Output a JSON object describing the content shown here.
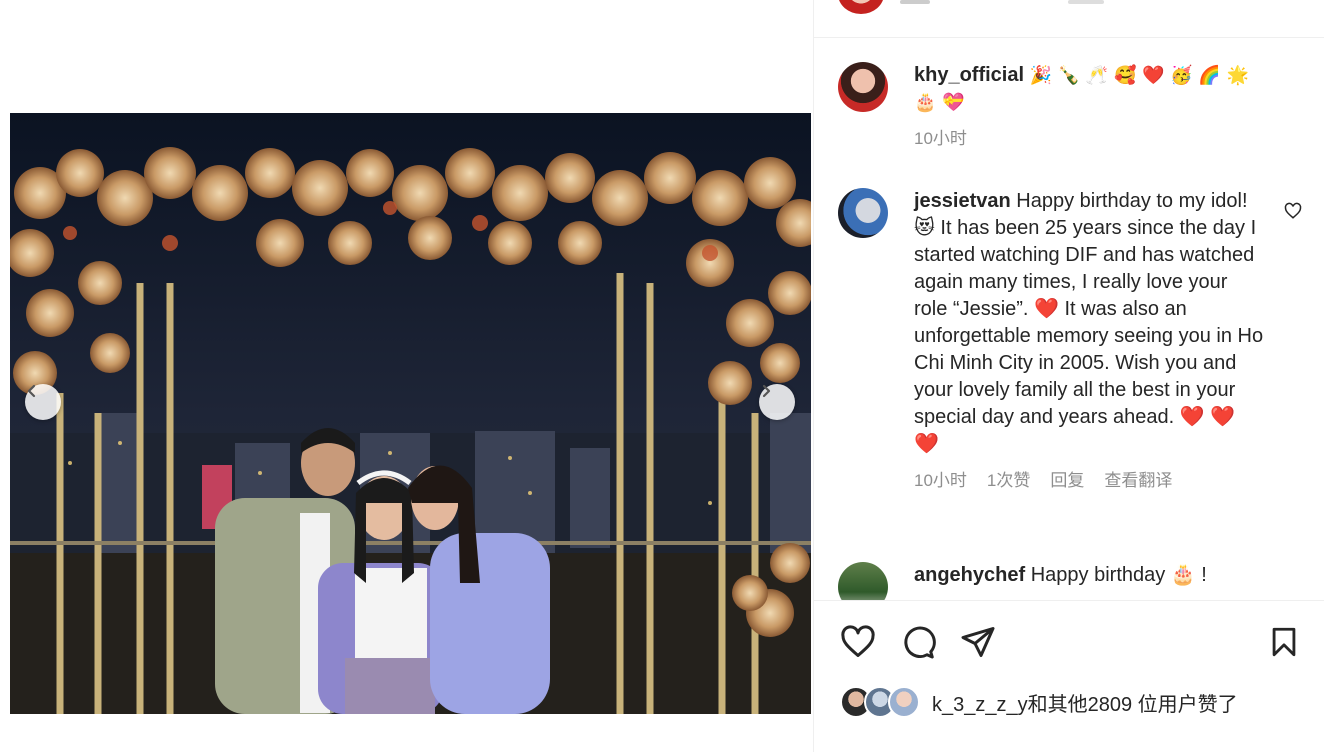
{
  "post_image": {
    "alt_subject": "family photo with floral arch",
    "prev_icon": "chevron-left-icon",
    "next_icon": "chevron-right-icon"
  },
  "comments": [
    {
      "username": "khy_official",
      "text": "🎉 🍾 🥂 🥰 ❤️ 🥳 🌈 🌟 🎂 💝",
      "time": "10小时",
      "likes": "",
      "reply": "",
      "translate": ""
    },
    {
      "username": "jessietvan",
      "text": "Happy birthday to my idol! 😻  It has been 25 years since the day I started watching DIF and has watched again many times, I really love your role “Jessie”. ❤️  It was also an unforgettable memory seeing you in Ho Chi Minh City in 2005. Wish you and your lovely family all the best in your special day and years ahead. ❤️ ❤️ ❤️",
      "time": "10小时",
      "likes": "1次赞",
      "reply": "回复",
      "translate": "查看翻译"
    },
    {
      "username": "angehychef",
      "text": "Happy birthday 🎂 !",
      "time": "",
      "likes": "",
      "reply": "",
      "translate": ""
    }
  ],
  "actions": {
    "like_icon": "heart-outline-icon",
    "comment_icon": "comment-bubble-icon",
    "share_icon": "paper-plane-icon",
    "save_icon": "bookmark-icon"
  },
  "likes_summary": {
    "text": "k_3_z_z_y和其他2809 位用户赞了"
  },
  "colors": {
    "text": "#262626",
    "secondary": "#8e8e8e",
    "divider": "#efefef",
    "heart_red": "#e3262f"
  }
}
